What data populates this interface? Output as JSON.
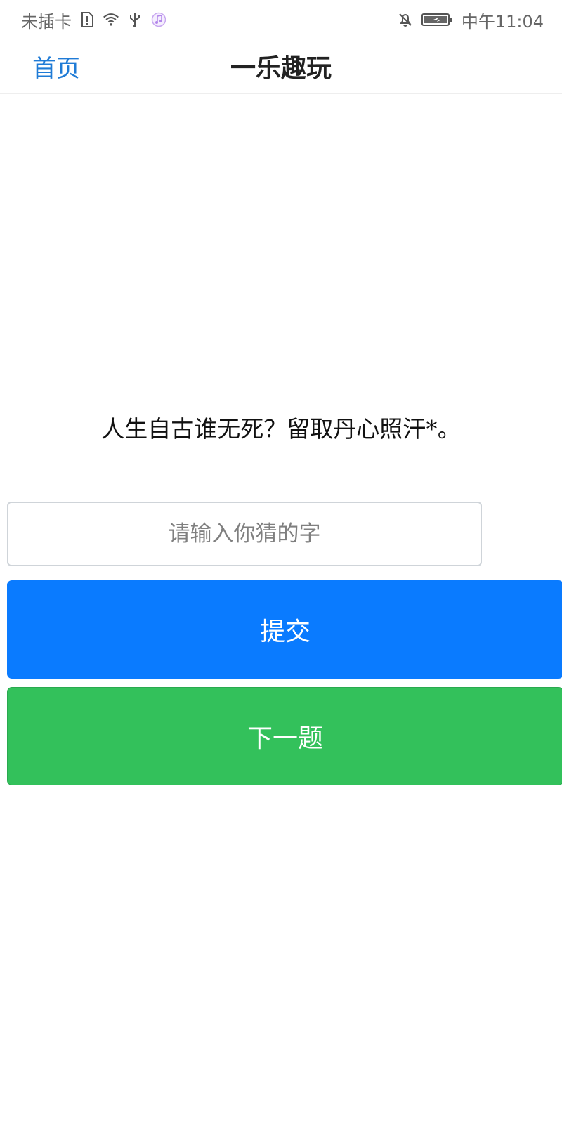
{
  "status_bar": {
    "carrier": "未插卡",
    "time": "中午11:04",
    "icons": [
      "sim-alert-icon",
      "wifi-icon",
      "usb-icon",
      "music-icon",
      "bell-off-icon",
      "battery-charging-icon"
    ]
  },
  "header": {
    "back_label": "首页",
    "title": "一乐趣玩"
  },
  "puzzle": {
    "question": "人生自古谁无死？留取丹心照汗*。",
    "input_placeholder": "请输入你猜的字"
  },
  "buttons": {
    "submit_label": "提交",
    "next_label": "下一题"
  },
  "colors": {
    "link_blue": "#1f7bd6",
    "submit_blue": "#0a7bff",
    "next_green": "#33c15b"
  }
}
